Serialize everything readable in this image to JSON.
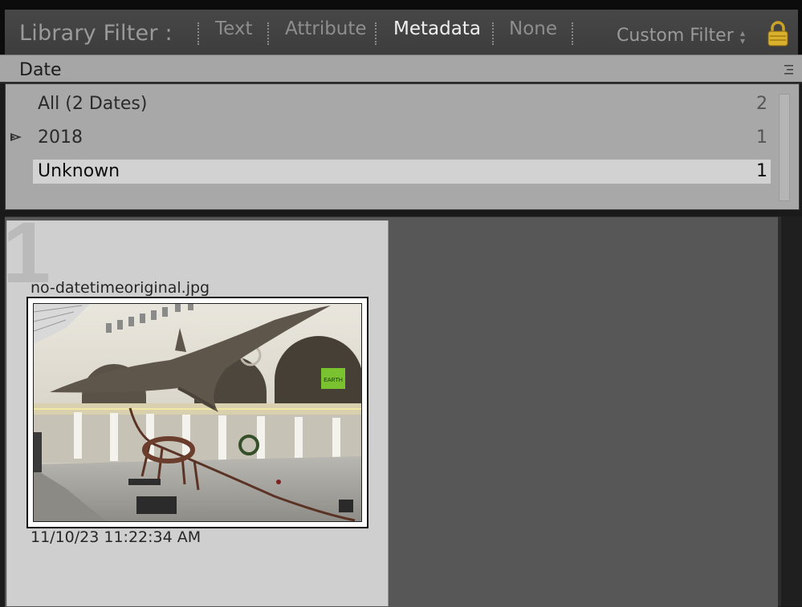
{
  "filter_bar": {
    "title": "Library Filter :",
    "tabs": [
      {
        "label": "Text",
        "active": false
      },
      {
        "label": "Attribute",
        "active": false
      },
      {
        "label": "Metadata",
        "active": true
      },
      {
        "label": "None",
        "active": false
      }
    ],
    "preset": "Custom Filter",
    "lock_icon": "lock-icon"
  },
  "metadata_column": {
    "header": "Date",
    "rows": [
      {
        "label": "All (2 Dates)",
        "count": "2",
        "selected": false,
        "expandable": false
      },
      {
        "label": "2018",
        "count": "1",
        "selected": false,
        "expandable": true
      },
      {
        "label": "Unknown",
        "count": "1",
        "selected": true,
        "expandable": false
      }
    ]
  },
  "grid": {
    "cells": [
      {
        "index": "1",
        "filename": "no-datetimeoriginal.jpg",
        "capture_time": "11/10/23 11:22:34 AM",
        "photo_sign": "EARTH"
      }
    ]
  },
  "colors": {
    "active_tab": "#efefef",
    "inactive_tab": "#8e8e8e",
    "selected_row": "#d2d2d2",
    "grid_background": "#575757",
    "cell_background": "#cfcfcf"
  }
}
